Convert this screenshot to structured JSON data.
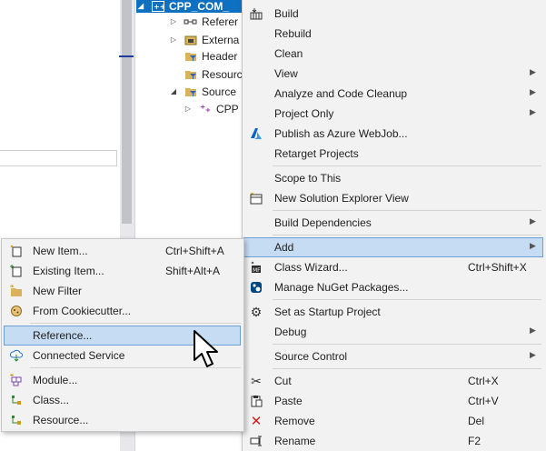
{
  "solution_explorer": {
    "project": {
      "label": "CPP_COM_"
    },
    "items": [
      {
        "label": "Referer",
        "icon": "references-icon",
        "expand": "collapsed"
      },
      {
        "label": "Externa",
        "icon": "external-deps-icon",
        "expand": "collapsed"
      },
      {
        "label": "Header",
        "icon": "filter-folder-icon",
        "expand": "none"
      },
      {
        "label": "Resourc",
        "icon": "filter-folder-icon",
        "expand": "none"
      },
      {
        "label": "Source",
        "icon": "filter-folder-icon",
        "expand": "expanded"
      },
      {
        "label": "CPP",
        "icon": "cpp-file-icon",
        "expand": "collapsed"
      }
    ]
  },
  "context_menu": {
    "items": [
      {
        "label": "Build",
        "icon": "build-icon"
      },
      {
        "label": "Rebuild"
      },
      {
        "label": "Clean"
      },
      {
        "label": "View",
        "submenu": true
      },
      {
        "label": "Analyze and Code Cleanup",
        "submenu": true
      },
      {
        "label": "Project Only",
        "submenu": true
      },
      {
        "label": "Publish as Azure WebJob...",
        "icon": "azure-icon"
      },
      {
        "label": "Retarget Projects"
      },
      {
        "label": "Scope to This"
      },
      {
        "label": "New Solution Explorer View",
        "icon": "new-view-icon"
      },
      {
        "label": "Build Dependencies",
        "submenu": true
      },
      {
        "label": "Add",
        "submenu": true,
        "highlighted": true
      },
      {
        "label": "Class Wizard...",
        "shortcut": "Ctrl+Shift+X",
        "icon": "class-wizard-icon"
      },
      {
        "label": "Manage NuGet Packages...",
        "icon": "nuget-icon"
      },
      {
        "label": "Set as Startup Project",
        "icon": "gear-icon"
      },
      {
        "label": "Debug",
        "submenu": true
      },
      {
        "label": "Source Control",
        "submenu": true
      },
      {
        "label": "Cut",
        "shortcut": "Ctrl+X",
        "icon": "scissors-icon"
      },
      {
        "label": "Paste",
        "shortcut": "Ctrl+V",
        "icon": "paste-icon"
      },
      {
        "label": "Remove",
        "shortcut": "Del",
        "icon": "remove-icon"
      },
      {
        "label": "Rename",
        "shortcut": "F2",
        "icon": "rename-icon"
      }
    ]
  },
  "add_submenu": {
    "items": [
      {
        "label": "New Item...",
        "shortcut": "Ctrl+Shift+A",
        "icon": "new-item-icon"
      },
      {
        "label": "Existing Item...",
        "shortcut": "Shift+Alt+A",
        "icon": "existing-item-icon"
      },
      {
        "label": "New Filter",
        "icon": "new-filter-icon"
      },
      {
        "label": "From Cookiecutter...",
        "icon": "cookiecutter-icon"
      },
      {
        "label": "Reference...",
        "highlighted": true
      },
      {
        "label": "Connected Service",
        "icon": "connected-service-icon"
      },
      {
        "label": "Module...",
        "icon": "module-icon"
      },
      {
        "label": "Class...",
        "icon": "class-icon"
      },
      {
        "label": "Resource...",
        "icon": "resource-icon"
      }
    ]
  },
  "colors": {
    "menu_bg": "#f2f2f2",
    "highlight_bg": "#c6dcf3",
    "highlight_border": "#6aa0d6",
    "selection_blue": "#0e70c0"
  }
}
